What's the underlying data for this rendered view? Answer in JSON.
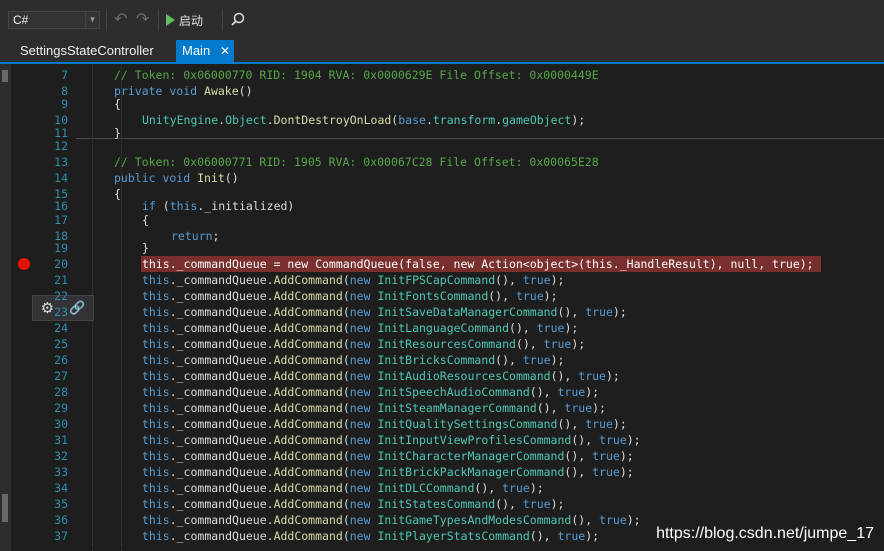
{
  "toolbar": {
    "language_value": "C#",
    "run_label": "启动"
  },
  "tabs": [
    {
      "label": "SettingsStateController",
      "active": false
    },
    {
      "label": "Main",
      "active": true
    }
  ],
  "editor": {
    "lines": [
      {
        "n": "7"
      },
      {
        "n": "8"
      },
      {
        "n": "9"
      },
      {
        "n": "10"
      },
      {
        "n": "11"
      },
      {
        "n": "12"
      },
      {
        "n": "13"
      },
      {
        "n": "14"
      },
      {
        "n": "15"
      },
      {
        "n": "16"
      },
      {
        "n": "17"
      },
      {
        "n": "18"
      },
      {
        "n": "19"
      },
      {
        "n": "20"
      },
      {
        "n": "21"
      },
      {
        "n": "22"
      },
      {
        "n": "23"
      },
      {
        "n": "24"
      },
      {
        "n": "25"
      },
      {
        "n": "26"
      },
      {
        "n": "27"
      },
      {
        "n": "28"
      },
      {
        "n": "29"
      },
      {
        "n": "30"
      },
      {
        "n": "31"
      },
      {
        "n": "32"
      },
      {
        "n": "33"
      },
      {
        "n": "34"
      },
      {
        "n": "35"
      },
      {
        "n": "36"
      },
      {
        "n": "37"
      }
    ],
    "code": {
      "l7": "// Token: 0x06000770 RID: 1904 RVA: 0x0000629E File Offset: 0x0000449E",
      "l8a": "private void ",
      "l8b": "Awake",
      "l8c": "()",
      "l9": "{",
      "l10a": "UnityEngine",
      "l10b": ".",
      "l10c": "Object",
      "l10d": ".",
      "l10e": "DontDestroyOnLoad",
      "l10f": "(",
      "l10g": "base",
      "l10h": ".",
      "l10i": "transform",
      "l10j": ".",
      "l10k": "gameObject",
      "l10l": ");",
      "l11": "}",
      "l13": "// Token: 0x06000771 RID: 1905 RVA: 0x00067C28 File Offset: 0x00065E28",
      "l14a": "public void ",
      "l14b": "Init",
      "l14c": "()",
      "l15": "{",
      "l16a": "if",
      "l16b": " (",
      "l16c": "this",
      "l16d": "._initialized)",
      "l17": "{",
      "l18a": "return",
      "l18b": ";",
      "l19": "}",
      "l20": "this._commandQueue = new CommandQueue(false, new Action<object>(this._HandleResult), null, true);",
      "cmdThis": "this",
      "cmdQ": "._commandQueue.",
      "cmdAdd": "AddCommand",
      "cmdOpen": "(",
      "cmdNew": "new",
      "cmdSp": " ",
      "cmdArgs": "(), ",
      "cmdTrue": "true",
      "cmdEnd": ");",
      "commands": [
        "InitFPSCapCommand",
        "InitFontsCommand",
        "InitSaveDataManagerCommand",
        "InitLanguageCommand",
        "InitResourcesCommand",
        "InitBricksCommand",
        "InitAudioResourcesCommand",
        "InitSpeechAudioCommand",
        "InitSteamManagerCommand",
        "InitQualitySettingsCommand",
        "InitInputViewProfilesCommand",
        "InitCharacterManagerCommand",
        "InitBrickPackManagerCommand",
        "InitDLCCommand",
        "InitStatesCommand",
        "InitGameTypesAndModesCommand",
        "InitPlayerStatsCommand"
      ]
    }
  },
  "watermark": "https://blog.csdn.net/jumpe_17"
}
